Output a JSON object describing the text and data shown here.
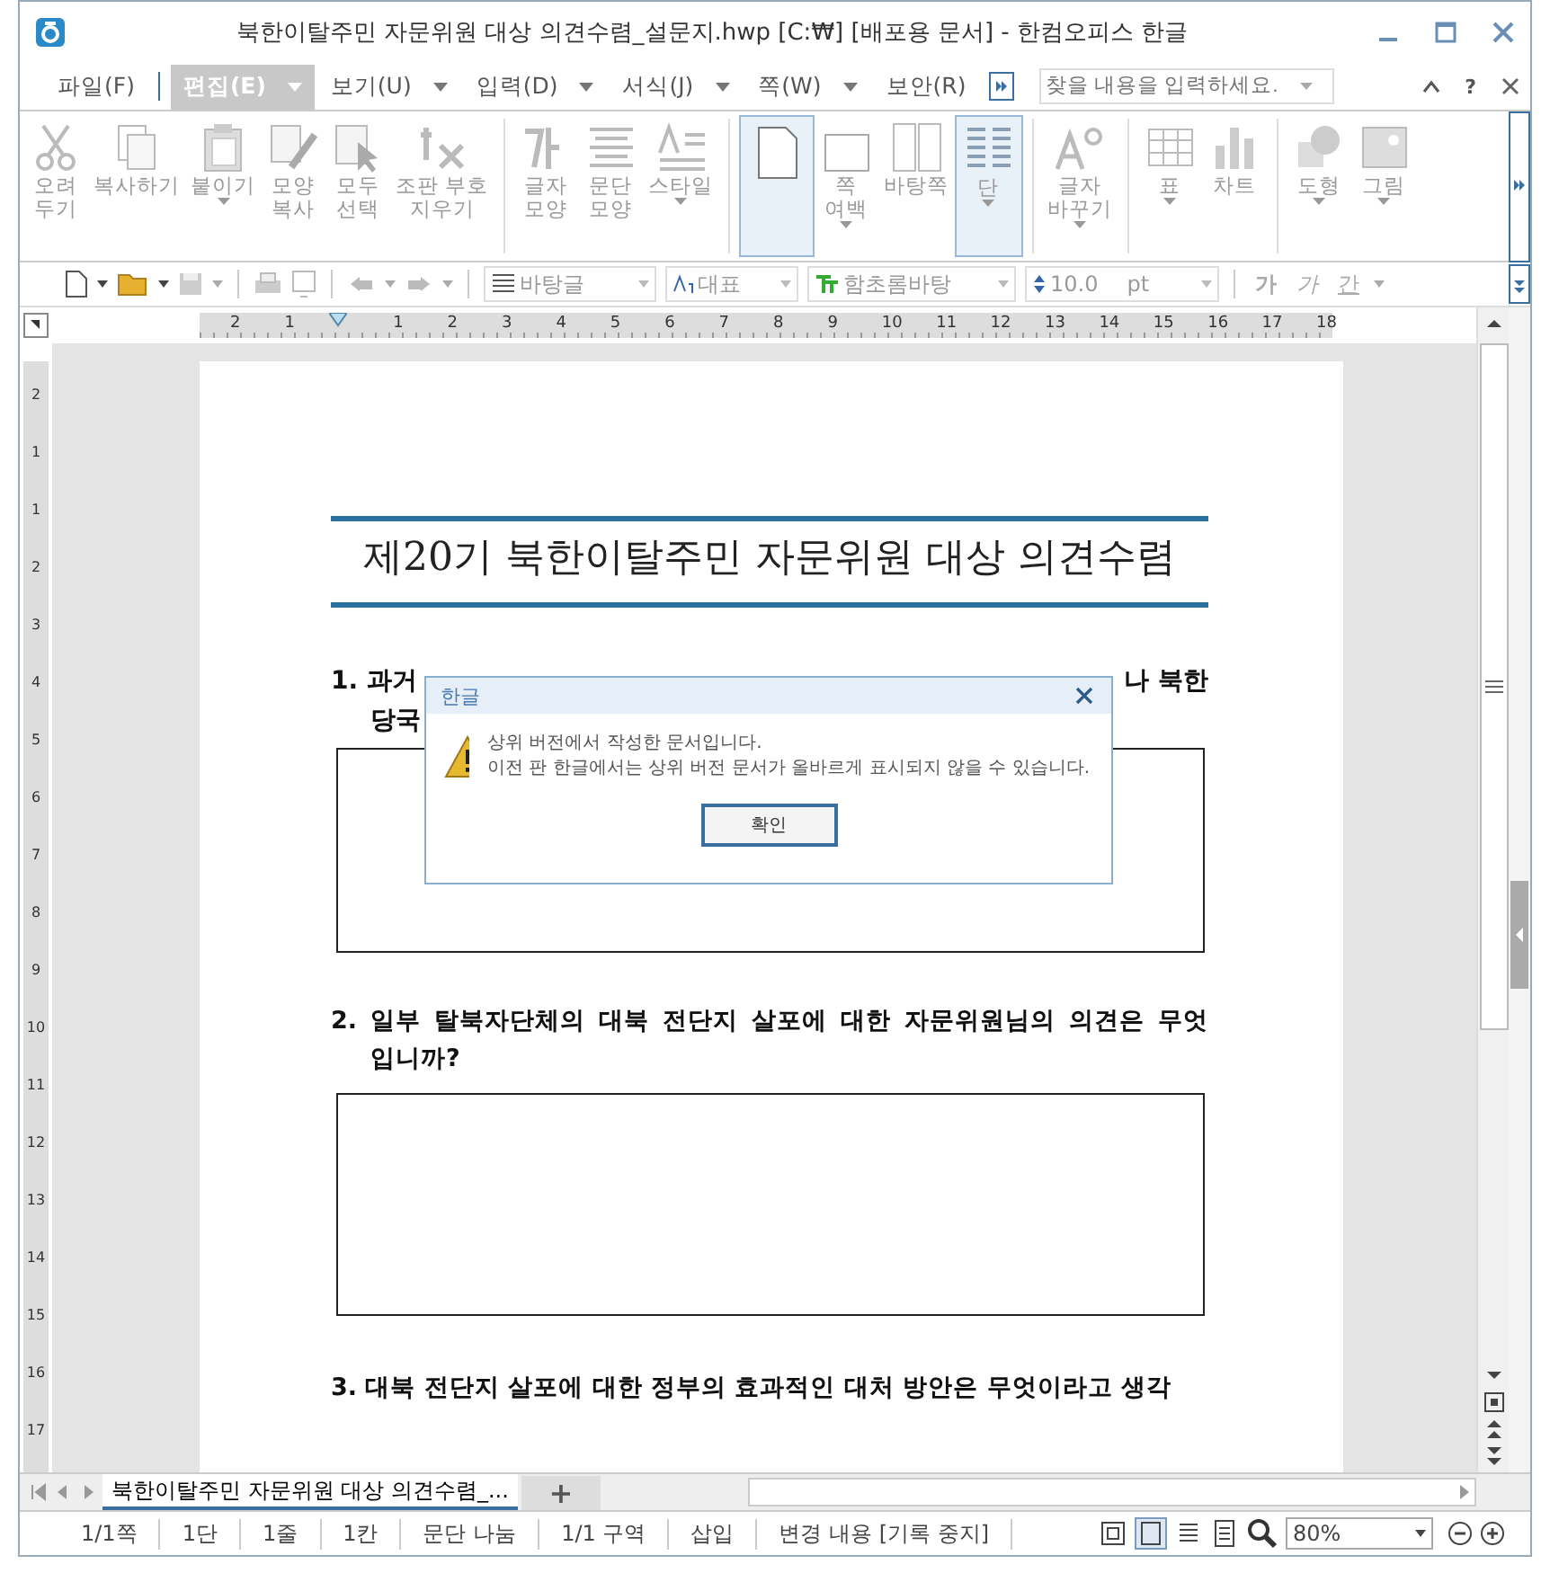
{
  "window": {
    "title": "북한이탈주민 자문위원 대상 의견수렴_설문지.hwp [C:₩] [배포용 문서] - 한컴오피스 한글"
  },
  "menu": [
    {
      "label": "파일(F)",
      "selected": false,
      "caret": false
    },
    {
      "label": "편집(E)",
      "selected": true,
      "caret": true
    },
    {
      "label": "보기(U)",
      "selected": false,
      "caret": true
    },
    {
      "label": "입력(D)",
      "selected": false,
      "caret": true
    },
    {
      "label": "서식(J)",
      "selected": false,
      "caret": true
    },
    {
      "label": "쪽(W)",
      "selected": false,
      "caret": true
    },
    {
      "label": "보안(R)",
      "selected": false,
      "caret": false
    }
  ],
  "search": {
    "placeholder": "찾을 내용을 입력하세요."
  },
  "help": "?",
  "ribbon": [
    [
      {
        "kind": "button",
        "label": "오려\n두기",
        "disabled": true,
        "selected": false,
        "caret": false
      },
      {
        "kind": "button",
        "label": "복사하기",
        "disabled": true,
        "selected": false,
        "caret": false
      },
      {
        "kind": "button",
        "label": "붙이기",
        "disabled": true,
        "selected": false,
        "caret": true
      },
      {
        "kind": "button",
        "label": "모양\n복사",
        "disabled": true,
        "selected": false,
        "caret": false
      },
      {
        "kind": "button",
        "label": "모두\n선택",
        "disabled": true,
        "selected": false,
        "caret": false
      },
      {
        "kind": "button",
        "label": "조판 부호\n지우기",
        "disabled": true,
        "selected": false,
        "caret": false
      }
    ],
    [
      {
        "kind": "button",
        "label": "글자\n모양",
        "disabled": true,
        "selected": false,
        "caret": false
      },
      {
        "kind": "button",
        "label": "문단\n모양",
        "disabled": true,
        "selected": false,
        "caret": false
      },
      {
        "kind": "button",
        "label": "스타일",
        "disabled": true,
        "selected": false,
        "caret": true
      }
    ],
    [
      {
        "kind": "icon",
        "disabled": false,
        "selected": true,
        "caret": false
      },
      {
        "kind": "button",
        "label": "쪽\n여백",
        "disabled": true,
        "selected": false,
        "caret": true
      },
      {
        "kind": "button",
        "label": "바탕쪽",
        "disabled": true,
        "selected": false,
        "caret": false
      },
      {
        "kind": "button",
        "label": "단",
        "disabled": true,
        "selected": true,
        "caret": true
      }
    ],
    [
      {
        "kind": "button",
        "label": "글자\n바꾸기",
        "disabled": true,
        "selected": false,
        "caret": true
      }
    ],
    [
      {
        "kind": "button",
        "label": "표",
        "disabled": true,
        "selected": false,
        "caret": true
      },
      {
        "kind": "button",
        "label": "차트",
        "disabled": true,
        "selected": false,
        "caret": false
      }
    ],
    [
      {
        "kind": "button",
        "label": "도형",
        "disabled": true,
        "selected": false,
        "caret": true
      },
      {
        "kind": "button",
        "label": "그림",
        "disabled": true,
        "selected": false,
        "caret": true
      }
    ]
  ],
  "format_bar": {
    "style": "바탕글",
    "language": "대표",
    "font": "함초롬바탕",
    "size": "10.0",
    "unit": "pt",
    "bold": "가",
    "italic": "가",
    "underline": "간"
  },
  "ruler": {
    "labels": [
      "2",
      "1",
      "1",
      "2",
      "3",
      "4",
      "5",
      "6",
      "7",
      "8",
      "9",
      "10",
      "11",
      "12",
      "13",
      "14",
      "15",
      "16",
      "17",
      "18"
    ]
  },
  "vertical_ruler": {
    "labels": [
      "2",
      "1",
      "1",
      "2",
      "3",
      "4",
      "5",
      "6",
      "7",
      "8",
      "9",
      "10",
      "11",
      "12",
      "13",
      "14",
      "15",
      "16",
      "17"
    ]
  },
  "document": {
    "title": "제20기 북한이탈주민 자문위원 대상 의견수렴",
    "question_1": {
      "start": "1.  과거",
      "end": "나 북한",
      "line_2": "당국"
    },
    "question_2": "2. 일부 탈북자단체의 대북 전단지 살포에 대한 자문위원님의 의견은 무엇 입니까?",
    "question_3": "3. 대북 전단지 살포에 대한 정부의 효과적인 대처 방안은 무엇이라고 생각"
  },
  "dialog": {
    "title": "한글",
    "lines": [
      "상위 버전에서 작성한 문서입니다.",
      "이전 판 한글에서는 상위 버전 문서가 올바르게 표시되지 않을 수 있습니다."
    ],
    "button": "확인"
  },
  "doc_tabs": [
    {
      "label": "북한이탈주민 자문위원 대상 의견수렴_...",
      "selected": true
    }
  ],
  "add_tab": "+",
  "status_bar": {
    "items": [
      "1/1쪽",
      "1단",
      "1줄",
      "1칸",
      "문단 나눔",
      "1/1 구역",
      "삽입",
      "변경 내용 [기록 중지]"
    ],
    "zoom": "80%"
  }
}
